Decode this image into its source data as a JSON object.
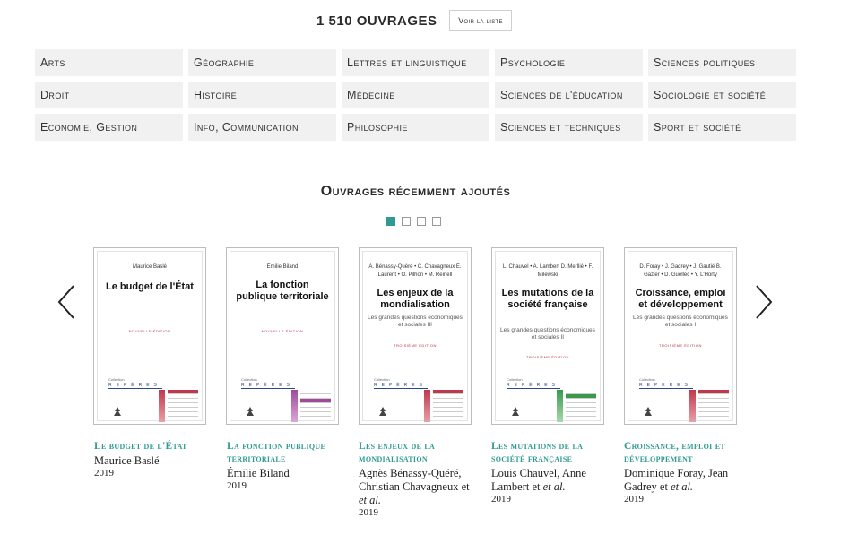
{
  "header": {
    "count": "1 510 ouvrages",
    "view_button": "Voir la liste"
  },
  "categories": [
    "Arts",
    "Géographie",
    "Lettres et linguistique",
    "Psychologie",
    "Sciences politiques",
    "Droit",
    "Histoire",
    "Médecine",
    "Sciences de l'éducation",
    "Sociologie et société",
    "Economie, Gestion",
    "Info, Communication",
    "Philosophie",
    "Sciences et techniques",
    "Sport et société"
  ],
  "section": {
    "title": "Ouvrages récemment ajoutés"
  },
  "books": [
    {
      "cover_authors": "Maurice Baslé",
      "cover_title": "Le budget de l'État",
      "cover_subtitle": "",
      "cover_edition": "nouvelle édition",
      "accent": "#c0394b",
      "title": "Le budget de l'État",
      "author": "Maurice Baslé",
      "year": "2019"
    },
    {
      "cover_authors": "Émilie Biland",
      "cover_title": "La fonction publique territoriale",
      "cover_subtitle": "",
      "cover_edition": "nouvelle édition",
      "accent": "#a04a9c",
      "title": "La fonction publique territoriale",
      "author": "Émilie Biland",
      "year": "2019"
    },
    {
      "cover_authors": "A. Bénassy-Quéré • C. Chavagneux É. Laurent • O. Pilhon • M. Reinell",
      "cover_title": "Les enjeux de la mondialisation",
      "cover_subtitle": "Les grandes questions économiques et sociales III",
      "cover_edition": "troisième édition",
      "accent": "#c0394b",
      "title": "Les enjeux de la mondialisation",
      "author_main": "Agnès Bénassy-Quéré, Christian Chavagneux et",
      "author_etal": "et al.",
      "year": "2019"
    },
    {
      "cover_authors": "L. Chauvel • A. Lambert D. Merllié • F. Milewski",
      "cover_title": "Les mutations de la société française",
      "cover_subtitle": "Les grandes questions économiques et sociales II",
      "cover_edition": "troisième édition",
      "accent": "#3a9a4a",
      "title": "Les mutations de la société française",
      "author_main": "Louis Chauvel, Anne Lambert et",
      "author_etal": "et al.",
      "year": "2019"
    },
    {
      "cover_authors": "D. Foray • J. Gadrey • J. Gautié B. Gazier • D. Guellec • Y. L'Horty",
      "cover_title": "Croissance, emploi et développement",
      "cover_subtitle": "Les grandes questions économiques et sociales I",
      "cover_edition": "troisième édition",
      "accent": "#c0394b",
      "title": "Croissance, emploi et développement",
      "author_main": "Dominique Foray, Jean Gadrey et",
      "author_etal": "et al.",
      "year": "2019"
    }
  ],
  "cover_common": {
    "collection": "Collection",
    "series": "REPÈRES",
    "publisher": "La Découverte"
  },
  "colors": {
    "accent": "#2f9a92"
  }
}
